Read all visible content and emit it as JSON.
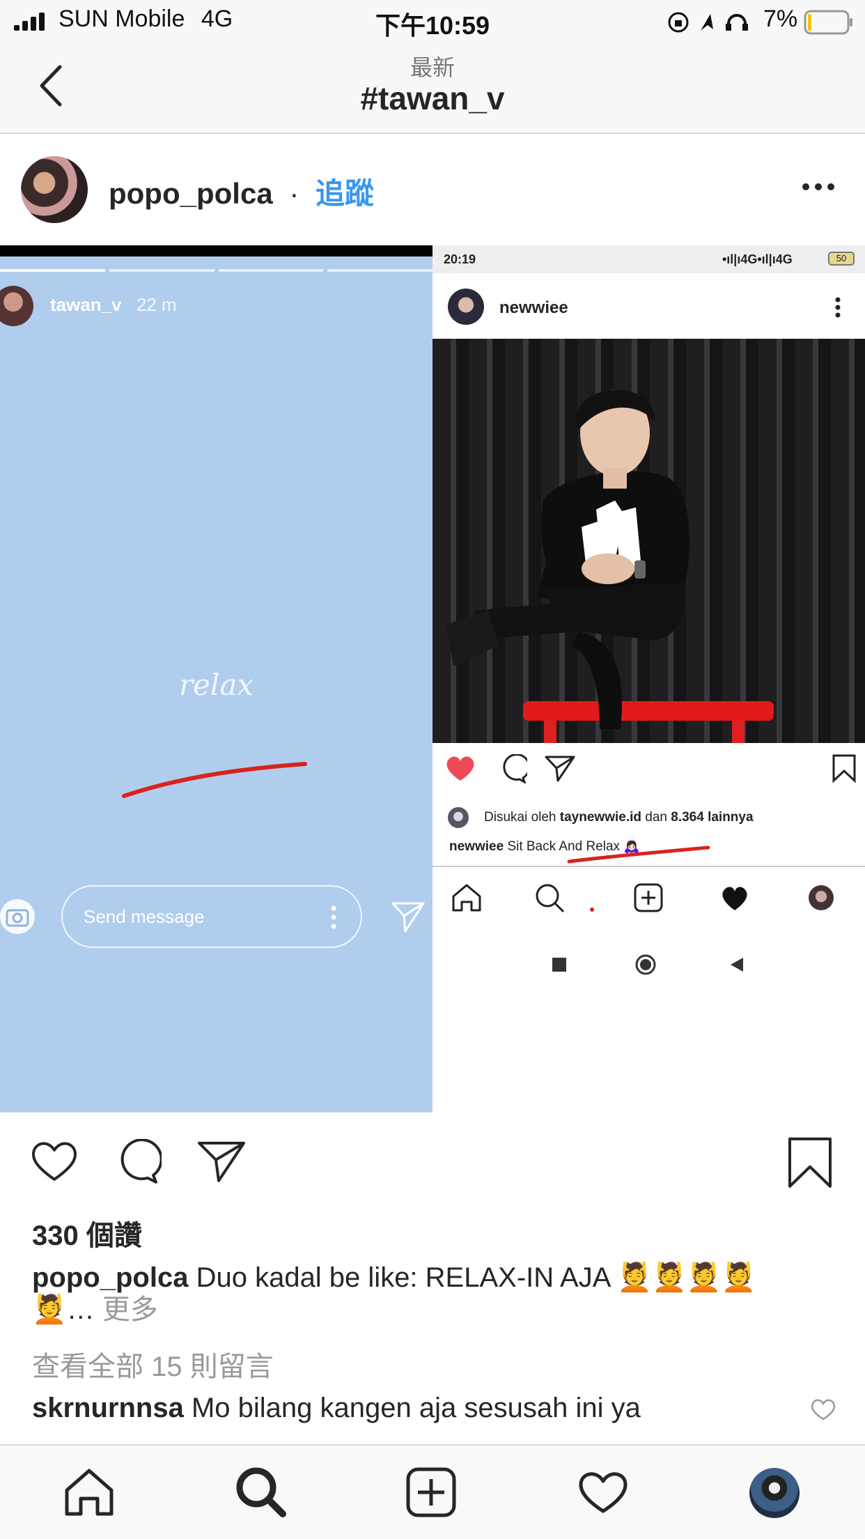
{
  "status_bar": {
    "carrier": "SUN Mobile",
    "network": "4G",
    "time": "下午10:59",
    "battery_percent": "7%"
  },
  "nav": {
    "subtitle": "最新",
    "title": "#tawan_v",
    "back_icon": "chevron-left-icon"
  },
  "post": {
    "username": "popo_polca",
    "separator": "·",
    "follow_label": "追蹤",
    "more_icon": "ellipsis-icon"
  },
  "story": {
    "username": "tawan_v",
    "time_ago": "22 m",
    "sticker_text": "relax",
    "message_placeholder": "Send message"
  },
  "inner_screenshot": {
    "time": "20:19",
    "status_right": "•ıl|ı4G•ıl|ı4G",
    "battery": "50",
    "username": "newwiee",
    "liked_prefix": "Disukai oleh",
    "liked_user": "taynewwie.id",
    "liked_mid": "dan",
    "liked_count": "8.364 lainnya",
    "caption_user": "newwiee",
    "caption_text": "Sit Back And Relax",
    "caption_emoji": "🙇🏻‍♀️"
  },
  "actions": {
    "like_icon": "heart-icon",
    "comment_icon": "comment-icon",
    "share_icon": "paper-plane-icon",
    "save_icon": "bookmark-icon"
  },
  "likes": "330 個讚",
  "caption": {
    "username": "popo_polca",
    "text": "Duo kadal be like: RELAX-IN AJA 💆💆💆💆",
    "text_line2": "💆… ",
    "more_label": "更多"
  },
  "view_comments": "查看全部 15 則留言",
  "comment": {
    "username": "skrnurnnsa",
    "text": "Mo bilang kangen aja sesusah ini ya"
  },
  "tab_bar": {
    "items": [
      "home-icon",
      "search-icon",
      "add-post-icon",
      "activity-heart-icon",
      "profile-avatar"
    ]
  },
  "colors": {
    "link_blue": "#3897f0",
    "story_bg": "#b1cdee",
    "like_red": "#ed4956",
    "underline_red": "#d9231e"
  }
}
